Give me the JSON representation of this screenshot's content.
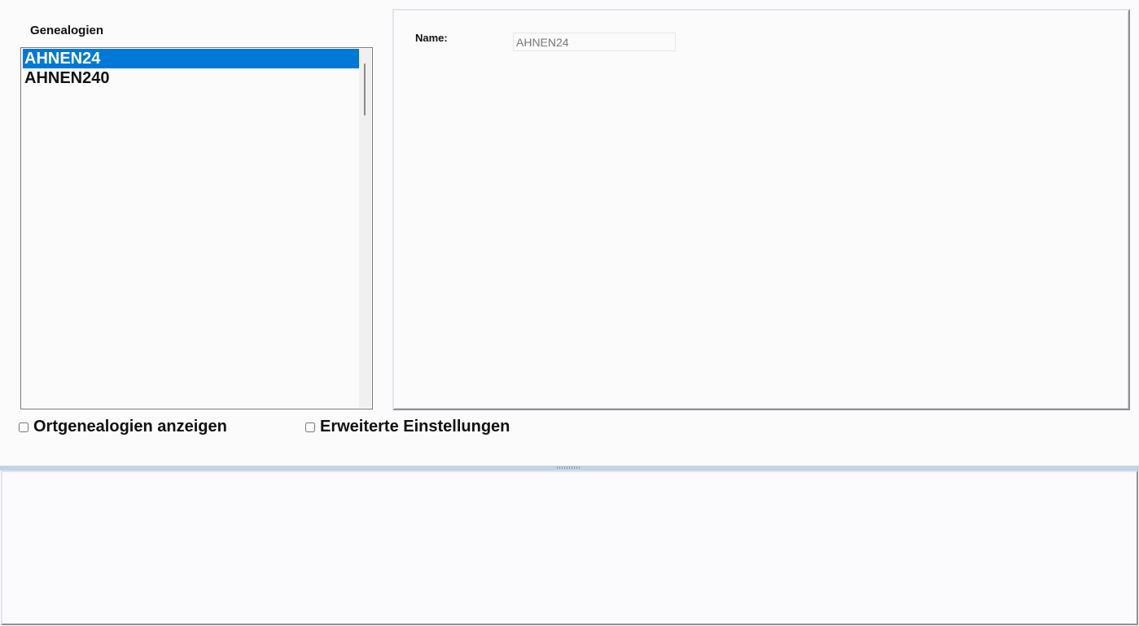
{
  "genealogies": {
    "title": "Genealogien",
    "items": [
      {
        "label": "AHNEN24",
        "selected": true
      },
      {
        "label": "AHNEN240",
        "selected": false
      }
    ]
  },
  "details": {
    "name_label": "Name:",
    "name_value": "AHNEN24"
  },
  "options": {
    "show_local_genealogies": {
      "label": "Ortgenealogien anzeigen",
      "checked": false
    },
    "advanced_settings": {
      "label": "Erweiterte Einstellungen",
      "checked": false
    }
  },
  "colors": {
    "selection": "#0078d7",
    "splitter": "#c3d3e6"
  }
}
